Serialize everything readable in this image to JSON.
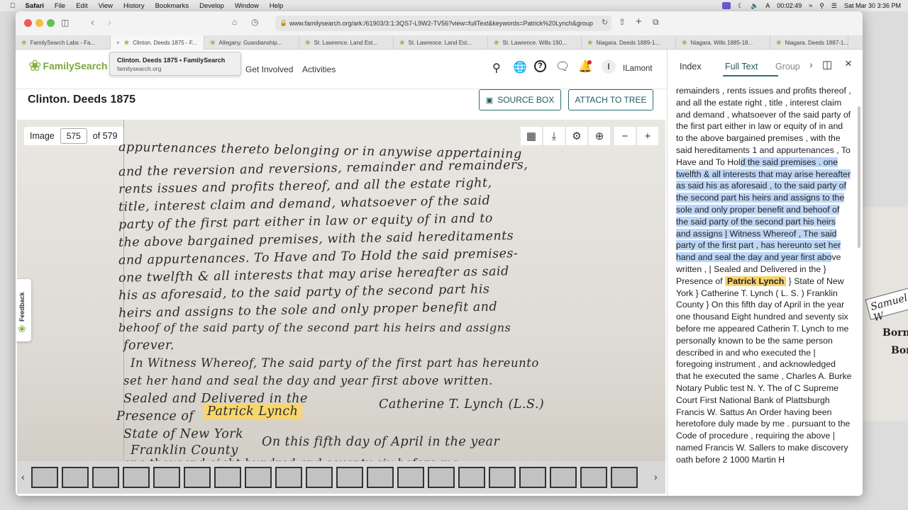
{
  "menubar": {
    "apple": "",
    "items": [
      "Safari",
      "File",
      "Edit",
      "View",
      "History",
      "Bookmarks",
      "Develop",
      "Window",
      "Help"
    ],
    "timer": "00:02:49",
    "datetime": "Sat Mar 30  3:36 PM"
  },
  "browser": {
    "url": "www.familysearch.org/ark:/61903/3:1:3QS7-L9W2-TV56?view=fullText&keywords=Patrick%20Lynch&group",
    "tabs": [
      {
        "label": "FamilySearch Labs - Fa...",
        "active": false
      },
      {
        "label": "Clinton. Deeds 1875 - F...",
        "active": true
      },
      {
        "label": "Allegany. Guardianship...",
        "active": false
      },
      {
        "label": "St. Lawrence. Land Est...",
        "active": false
      },
      {
        "label": "St. Lawrence. Land Est...",
        "active": false
      },
      {
        "label": "St. Lawrence. Wills 190...",
        "active": false
      },
      {
        "label": "Niagara. Deeds 1889-1...",
        "active": false
      },
      {
        "label": "Niagara. Wills 1885-18...",
        "active": false
      },
      {
        "label": "Niagara. Deeds 1887-1...",
        "active": false
      }
    ],
    "tooltip": {
      "title": "Clinton. Deeds 1875 • FamilySearch",
      "domain": "familysearch.org"
    }
  },
  "site": {
    "logo": "FamilySearch",
    "nav": [
      "Get Involved",
      "Activities"
    ],
    "user": "ILamont",
    "user_initial": "I"
  },
  "record": {
    "title": "Clinton. Deeds 1875",
    "source_box": "SOURCE BOX",
    "attach": "ATTACH TO TREE"
  },
  "viewer": {
    "image_label": "Image",
    "image_number": "575",
    "of_total": "of 579",
    "lines": [
      "appurtenances thereto belonging or in anywise appertaining",
      "and the reversion and reversions, remainder and remainders,",
      "rents issues and profits thereof, and all the estate right,",
      "title, interest claim and demand, whatsoever of the said",
      "party of the first part either in law or equity of in and to",
      "the above bargained premises, with the said hereditaments",
      "and appurtenances. To Have and To Hold the said premises-",
      "one twelfth & all interests that may arise hereafter as said",
      "his as aforesaid, to the said party of the second part his",
      "heirs and assigns to the sole and only proper benefit and",
      "behoof of the said party of the second part his heirs and assigns",
      "forever.",
      "In Witness Whereof, The said party of the first part has hereunto",
      "set her hand and seal the day and year first above written.",
      "Sealed and Delivered in the",
      "Presence of",
      "Patrick Lynch",
      "Catherine T. Lynch (L.S.)",
      "State of New York",
      "Franklin County",
      "On this fifth day of April in the year",
      "one thousand eight hundred and seventy six before me"
    ]
  },
  "feedback": "Feedback",
  "panel": {
    "tabs": [
      "Index",
      "Full Text",
      "Group"
    ],
    "text": {
      "p1": "remainders , rents issues and profits thereof , and all the estate right , title , interest claim and demand , whatsoever of the said party of the first part either in law or equity of in and to the above bargained premises , with the said hereditaments 1 and appurtenances , To Have and To Hol",
      "sel": "d the said premises . one twelfth & all interests that may arise hereafter as said his as aforesaid , to the said party of the second part his heirs and assigns to the sole and only proper benefit and behoof of the said party of the second part his heirs and assigns  |  Witness Whereof , The said party of the first part , has hereunto set her hand and seal the day and year first abo",
      "p2": "ve written ,  |  Sealed and Delivered in the  }  Presence of",
      "hl": "Patrick  Lynch",
      "p3": "}  State of New York  }  Catherine T. Lynch ( L. S. )  Franklin County  }  On this fifth day of April in the year one thousand Eight hundred and seventy six before me appeared Catherin T. Lynch to me personally known to be the same person described in and who executed the  |  foregoing instrument , and acknowledged that he executed the same , Charles A. Burke Notary Public test N. Y. The of C Supreme Court First National Bank of Plattsburgh Francis W. Sattus An Order having been heretofore duly made by me . pursuant to the Code of procedure , requiring the above  |  named Francis W. Sallers to make discovery oath before 2 1000 Martin H"
    }
  },
  "background": {
    "text": "Samuel W",
    "born1": "Born",
    "born2": "Bor"
  }
}
